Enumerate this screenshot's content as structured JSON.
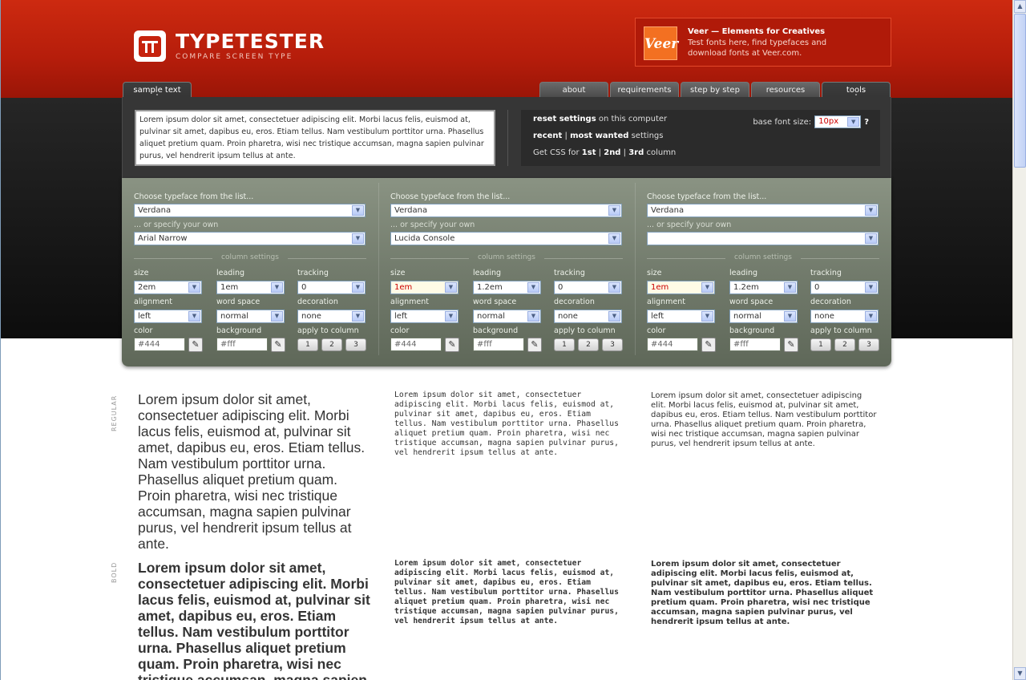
{
  "logo": {
    "title": "TYPETESTER",
    "subtitle": "COMPARE SCREEN TYPE"
  },
  "ad": {
    "logo_text": "Veer",
    "title": "Veer — Elements for Creatives",
    "text": "Test fonts here, find typefaces and download fonts at Veer.com."
  },
  "tabs": {
    "sample_text": "sample text",
    "about": "about",
    "requirements": "requirements",
    "step_by_step": "step by step",
    "resources": "resources",
    "tools": "tools"
  },
  "sample_text": "Lorem ipsum dolor sit amet, consectetuer adipiscing elit. Morbi lacus felis, euismod at, pulvinar sit amet, dapibus eu, eros. Etiam tellus. Nam vestibulum porttitor urna. Phasellus aliquet pretium quam. Proin pharetra, wisi nec tristique accumsan, magna sapien pulvinar purus, vel hendrerit ipsum tellus at ante.",
  "settings": {
    "reset": "reset settings",
    "reset_suffix": " on this computer",
    "recent": "recent",
    "sep1": " | ",
    "most_wanted": "most wanted",
    "settings_suffix": " settings",
    "css_prefix": "Get CSS for ",
    "first": "1st",
    "sep2": " | ",
    "second": "2nd",
    "sep3": " | ",
    "third": "3rd",
    "css_suffix": " column",
    "base_font_label": "base font size:",
    "base_font_value": "10px",
    "help": "?"
  },
  "labels": {
    "choose": "Choose typeface from the list...",
    "specify": "... or specify your own",
    "column_settings": "column settings",
    "size": "size",
    "leading": "leading",
    "tracking": "tracking",
    "alignment": "alignment",
    "word_space": "word space",
    "decoration": "decoration",
    "color": "color",
    "background": "background",
    "apply": "apply to column"
  },
  "columns": [
    {
      "typeface": "Verdana",
      "custom": "Arial Narrow",
      "size": "2em",
      "leading": "1em",
      "tracking": "0",
      "alignment": "left",
      "word_space": "normal",
      "decoration": "none",
      "color": "#444",
      "background": "#fff"
    },
    {
      "typeface": "Verdana",
      "custom": "Lucida Console",
      "size": "1em",
      "leading": "1.2em",
      "tracking": "0",
      "alignment": "left",
      "word_space": "normal",
      "decoration": "none",
      "color": "#444",
      "background": "#fff"
    },
    {
      "typeface": "Verdana",
      "custom": "",
      "size": "1em",
      "leading": "1.2em",
      "tracking": "0",
      "alignment": "left",
      "word_space": "normal",
      "decoration": "none",
      "color": "#444",
      "background": "#fff"
    }
  ],
  "apply_buttons": [
    "1",
    "2",
    "3"
  ],
  "sections": {
    "regular": "REGULAR",
    "bold": "BOLD"
  },
  "colors": {
    "header_red": "#c6230e",
    "panel_green": "#727b6c",
    "size_highlight": "#cc0000"
  }
}
